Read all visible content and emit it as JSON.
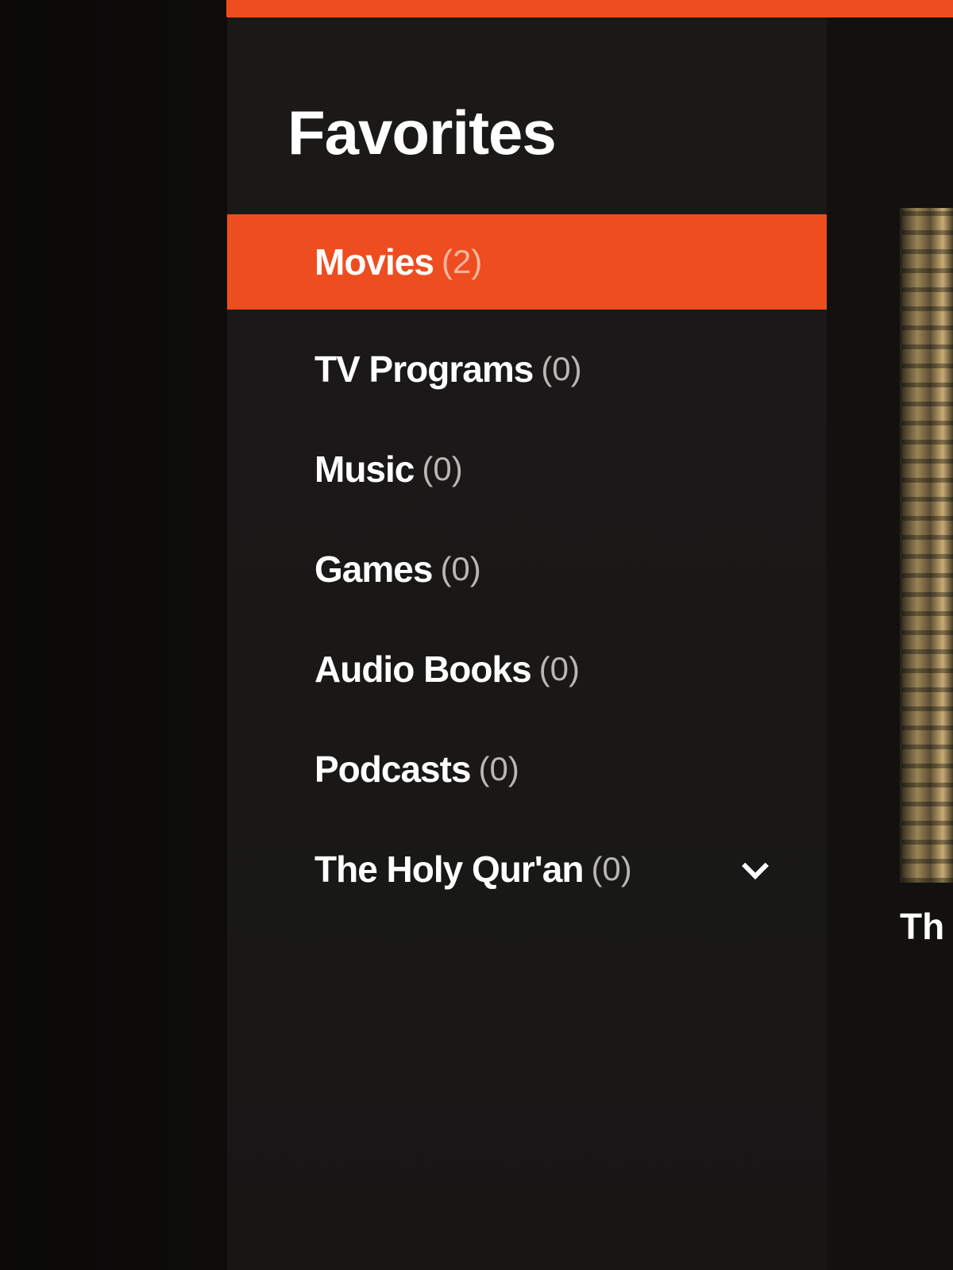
{
  "colors": {
    "accent": "#ee4e1f",
    "panel_background": "#1a1918",
    "text_primary": "#ffffff",
    "text_count": "#b9b7b4"
  },
  "panel": {
    "title": "Favorites",
    "categories": [
      {
        "label": "Movies",
        "count": "(2)",
        "active": true
      },
      {
        "label": "TV Programs",
        "count": "(0)",
        "active": false
      },
      {
        "label": "Music",
        "count": "(0)",
        "active": false
      },
      {
        "label": "Games",
        "count": "(0)",
        "active": false
      },
      {
        "label": "Audio Books",
        "count": "(0)",
        "active": false
      },
      {
        "label": "Podcasts",
        "count": "(0)",
        "active": false
      },
      {
        "label": "The Holy Qur'an",
        "count": "(0)",
        "active": false,
        "icon": "chevron-down-icon"
      }
    ]
  },
  "content": {
    "poster_title_fragment": "Th"
  }
}
